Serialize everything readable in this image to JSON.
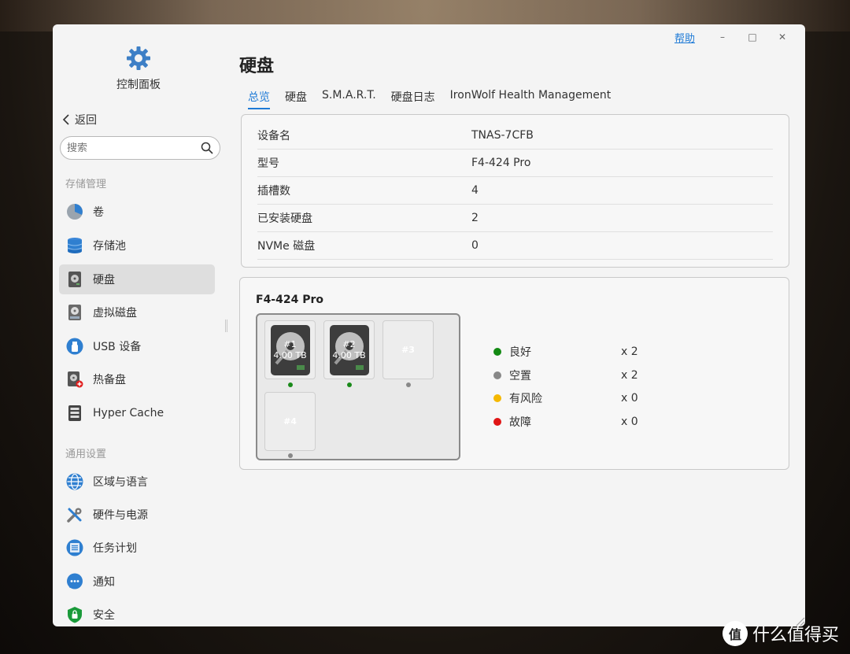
{
  "window": {
    "help_label": "帮助",
    "minimize": "–",
    "maximize": "□",
    "close": "✕"
  },
  "sidebar": {
    "app_title": "控制面板",
    "back_label": "返回",
    "search_placeholder": "搜索",
    "groups": [
      {
        "title": "存储管理"
      },
      {
        "title": "通用设置"
      }
    ],
    "items": [
      {
        "label": "卷",
        "icon": "volume-pie-icon"
      },
      {
        "label": "存储池",
        "icon": "storage-pool-icon"
      },
      {
        "label": "硬盘",
        "icon": "hard-disk-icon",
        "active": true
      },
      {
        "label": "虚拟磁盘",
        "icon": "virtual-disk-icon"
      },
      {
        "label": "USB 设备",
        "icon": "usb-icon"
      },
      {
        "label": "热备盘",
        "icon": "hot-spare-icon"
      },
      {
        "label": "Hyper Cache",
        "icon": "hyper-cache-icon"
      },
      {
        "label": "区域与语言",
        "icon": "globe-icon"
      },
      {
        "label": "硬件与电源",
        "icon": "tools-icon"
      },
      {
        "label": "任务计划",
        "icon": "task-list-icon"
      },
      {
        "label": "通知",
        "icon": "chat-bubble-icon"
      },
      {
        "label": "安全",
        "icon": "shield-icon"
      }
    ]
  },
  "main": {
    "title": "硬盘",
    "tabs": [
      {
        "label": "总览",
        "active": true
      },
      {
        "label": "硬盘"
      },
      {
        "label": "S.M.A.R.T."
      },
      {
        "label": "硬盘日志"
      },
      {
        "label": "IronWolf Health Management"
      }
    ],
    "info": [
      {
        "key": "设备名",
        "value": "TNAS-7CFB"
      },
      {
        "key": "型号",
        "value": "F4-424 Pro"
      },
      {
        "key": "插槽数",
        "value": "4"
      },
      {
        "key": "已安装硬盘",
        "value": "2"
      },
      {
        "key": "NVMe 磁盘",
        "value": "0"
      }
    ],
    "bay": {
      "title": "F4-424 Pro",
      "slots": [
        {
          "num": "#1",
          "size": "4.00 TB",
          "installed": true,
          "status_color": "#1a8a1a"
        },
        {
          "num": "#2",
          "size": "4.00 TB",
          "installed": true,
          "status_color": "#1a8a1a"
        },
        {
          "num": "#3",
          "size": "",
          "installed": false,
          "status_color": "#888888"
        },
        {
          "num": "#4",
          "size": "",
          "installed": false,
          "status_color": "#888888"
        }
      ]
    },
    "legend": [
      {
        "label": "良好",
        "count": "x 2",
        "color": "#138a13"
      },
      {
        "label": "空置",
        "count": "x 2",
        "color": "#888888"
      },
      {
        "label": "有风险",
        "count": "x 0",
        "color": "#f5b800"
      },
      {
        "label": "故障",
        "count": "x 0",
        "color": "#e01515"
      }
    ]
  },
  "watermark": {
    "badge": "值",
    "text": "什么值得买"
  },
  "colors": {
    "accent": "#1e7ad6",
    "good": "#138a13",
    "empty": "#888888",
    "risk": "#f5b800",
    "fault": "#e01515"
  }
}
